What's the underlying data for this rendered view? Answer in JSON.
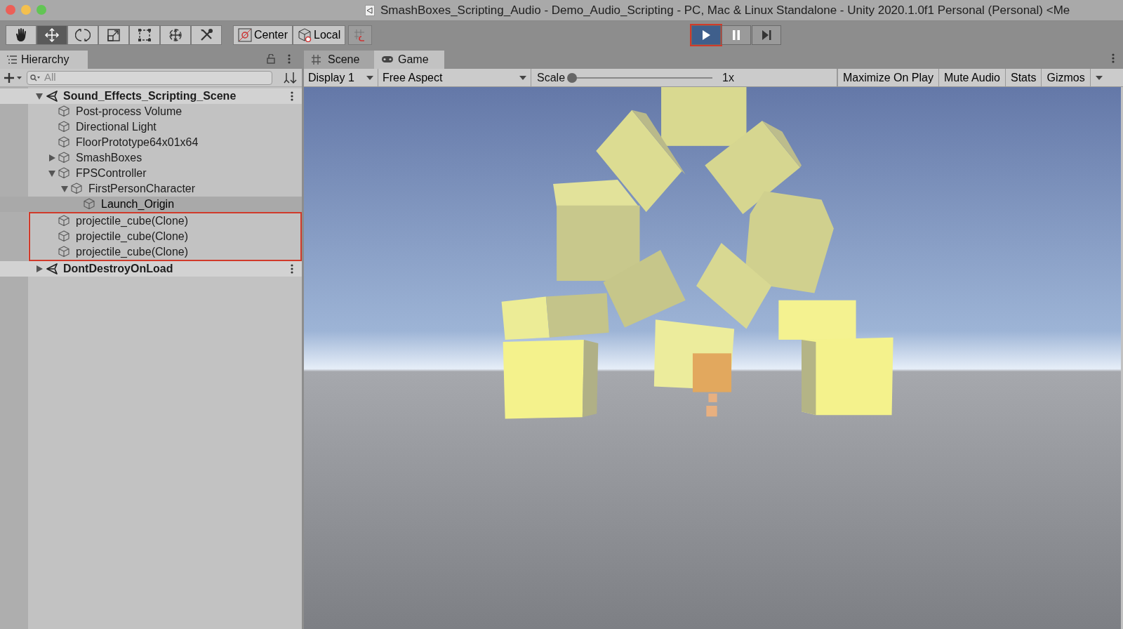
{
  "window": {
    "title": "SmashBoxes_Scripting_Audio - Demo_Audio_Scripting - PC, Mac & Linux Standalone - Unity 2020.1.0f1 Personal (Personal) <Me"
  },
  "tools": [
    {
      "kind": "hand",
      "selected": false
    },
    {
      "kind": "move",
      "selected": true
    },
    {
      "kind": "rotate",
      "selected": false
    },
    {
      "kind": "scale",
      "selected": false
    },
    {
      "kind": "rect",
      "selected": false
    },
    {
      "kind": "transform",
      "selected": false
    },
    {
      "kind": "custom",
      "selected": false
    }
  ],
  "pivot_buttons": [
    {
      "kind": "center",
      "label": "Center"
    },
    {
      "kind": "local",
      "label": "Local"
    },
    {
      "kind": "snap"
    }
  ],
  "play_controls": [
    {
      "kind": "play",
      "selected": true,
      "callout": true
    },
    {
      "kind": "pause",
      "selected": false,
      "callout": false
    },
    {
      "kind": "step",
      "selected": false,
      "callout": false
    }
  ],
  "hierarchy": {
    "tab": "Hierarchy",
    "search": {
      "placeholder": "All"
    },
    "items": [
      {
        "kind": "scene",
        "label": "Sound_Effects_Scripting_Scene",
        "expanded": true,
        "selected": false,
        "children": [
          {
            "kind": "object",
            "label": "Post-process Volume",
            "selected": false
          },
          {
            "kind": "object",
            "label": "Directional Light",
            "selected": false
          },
          {
            "kind": "object",
            "label": "FloorPrototype64x01x64",
            "selected": false
          },
          {
            "kind": "object",
            "label": "SmashBoxes",
            "expanded": false,
            "selected": false
          },
          {
            "kind": "object",
            "label": "FPSController",
            "expanded": true,
            "selected": false,
            "children": [
              {
                "kind": "object",
                "label": "FirstPersonCharacter",
                "expanded": true,
                "selected": false,
                "children": [
                  {
                    "kind": "object",
                    "label": "Launch_Origin",
                    "selected": true
                  }
                ]
              }
            ]
          },
          {
            "kind": "object",
            "label": "projectile_cube(Clone)",
            "selected": false,
            "callout": true
          },
          {
            "kind": "object",
            "label": "projectile_cube(Clone)",
            "selected": false,
            "callout": true
          },
          {
            "kind": "object",
            "label": "projectile_cube(Clone)",
            "selected": false,
            "callout": true
          }
        ]
      },
      {
        "kind": "scene",
        "label": "DontDestroyOnLoad",
        "expanded": false,
        "selected": false
      }
    ]
  },
  "view_tabs": [
    {
      "kind": "scene",
      "label": "Scene",
      "selected": false
    },
    {
      "kind": "game",
      "label": "Game",
      "selected": true
    }
  ],
  "game_toolbar": {
    "display": "Display 1",
    "aspect": "Free Aspect",
    "scale_label": "Scale",
    "scale": {
      "level": 0
    },
    "scale_reading": "1x",
    "buttons": [
      "Maximize On Play",
      "Mute Audio",
      "Stats",
      "Gizmos"
    ]
  }
}
